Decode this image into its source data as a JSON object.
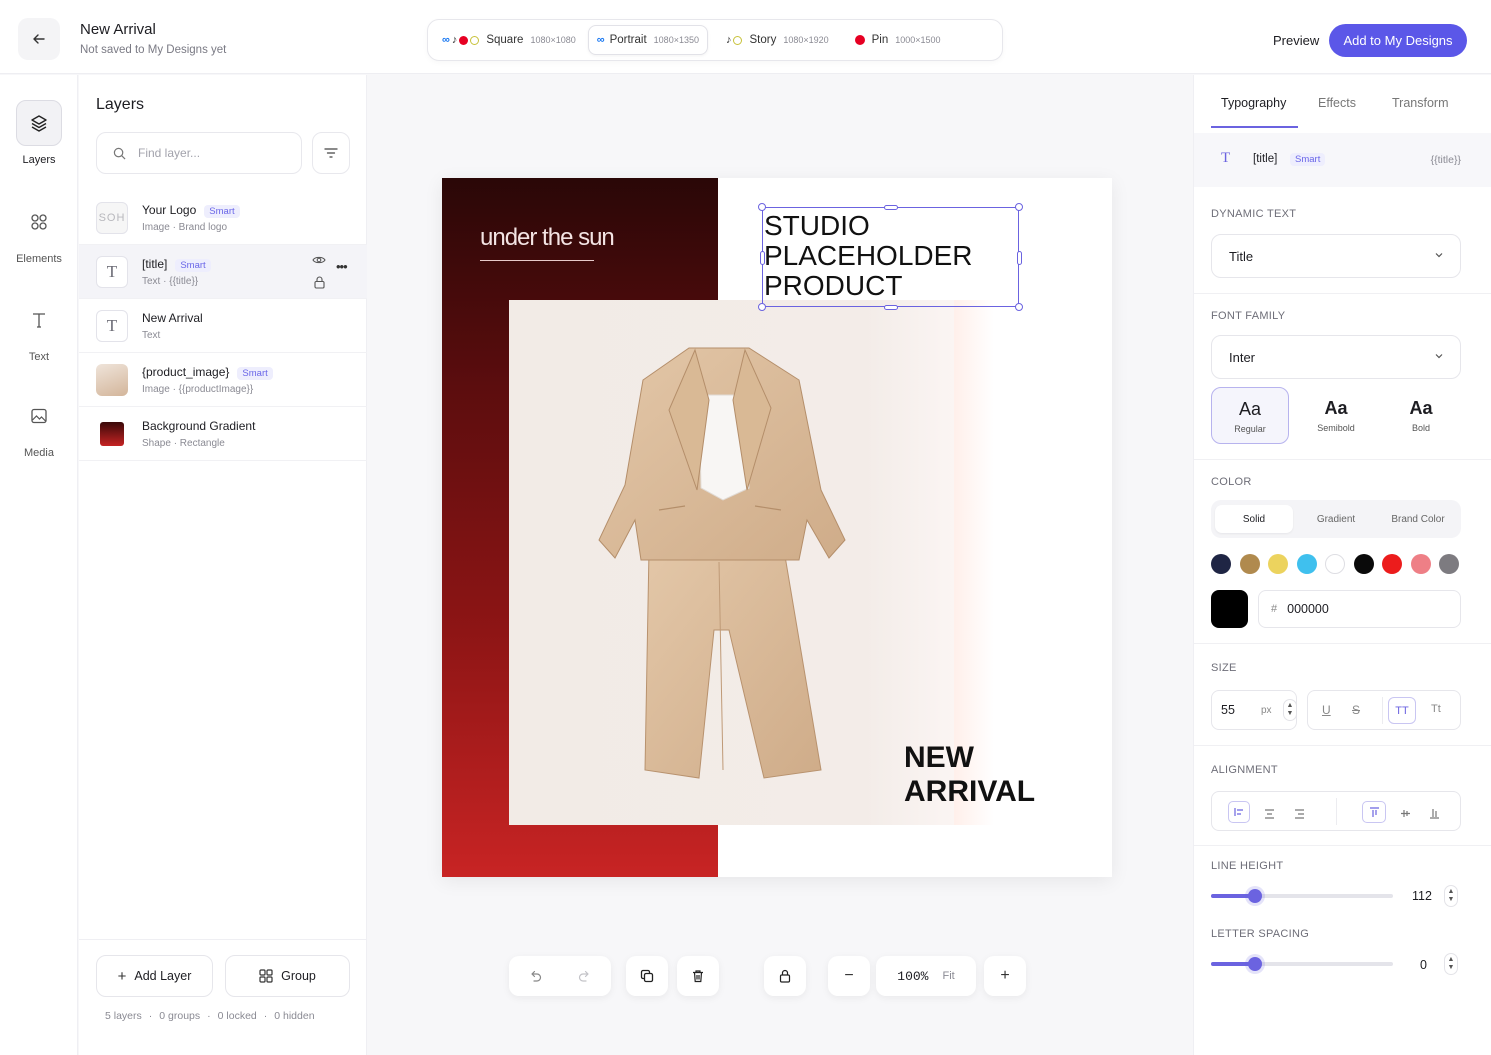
{
  "header": {
    "title": "New Arrival",
    "subtitle": "Not saved to My Designs yet",
    "preview_label": "Preview",
    "add_label": "Add to My Designs",
    "formats": [
      {
        "name": "Square",
        "dim": "1080×1080"
      },
      {
        "name": "Portrait",
        "dim": "1080×1350",
        "active": true
      },
      {
        "name": "Story",
        "dim": "1080×1920"
      },
      {
        "name": "Pin",
        "dim": "1000×1500"
      }
    ]
  },
  "rail": [
    {
      "label": "Layers",
      "icon": "layers-icon",
      "active": true
    },
    {
      "label": "Elements",
      "icon": "elements-icon"
    },
    {
      "label": "Text",
      "icon": "text-icon"
    },
    {
      "label": "Media",
      "icon": "image-icon"
    }
  ],
  "layers": {
    "title": "Layers",
    "search_placeholder": "Find layer...",
    "items": [
      {
        "name": "Your Logo",
        "smart": "Smart",
        "sub": "Image · Brand logo"
      },
      {
        "name": "[title]",
        "smart": "Smart",
        "sub": "Text · {{title}}"
      },
      {
        "name": "New Arrival",
        "smart": "",
        "sub": "Text"
      },
      {
        "name": "{product_image}",
        "smart": "Smart",
        "sub": "Image · {{productImage}}"
      },
      {
        "name": "Background Gradient",
        "smart": "",
        "sub": "Shape · Rectangle"
      }
    ],
    "add_layer_label": "Add Layer",
    "group_label": "Group",
    "stats": {
      "layers": "5 layers",
      "groups": "0 groups",
      "locked": "0 locked",
      "hidden": "0 hidden"
    }
  },
  "canvas": {
    "brand_text": "under the sun",
    "logo_thumb_text": "SOH",
    "title_text": "STUDIO\nPLACEHOLDER\nPRODUCT",
    "new_arrival_text": "NEW\nARRIVAL"
  },
  "toolbar": {
    "zoom": "100%",
    "fit_label": "Fit"
  },
  "props": {
    "tabs": [
      "Typography",
      "Effects",
      "Transform"
    ],
    "active_tab": "Typography",
    "chip": {
      "name": "[title]",
      "smart": "Smart",
      "token": "{{title}}"
    },
    "dynamic_text_label": "DYNAMIC TEXT",
    "dynamic_text_value": "Title",
    "font_family_label": "FONT FAMILY",
    "font_family_value": "Inter",
    "weights": [
      {
        "aa": "Aa",
        "label": "Regular",
        "active": true
      },
      {
        "aa": "Aa",
        "label": "Semibold"
      },
      {
        "aa": "Aa",
        "label": "Bold"
      }
    ],
    "color_label": "COLOR",
    "color_tabs": [
      "Solid",
      "Gradient",
      "Brand Color"
    ],
    "swatches": [
      "#1f2544",
      "#b08a4e",
      "#ecd35e",
      "#3fc0ee",
      "#ffffff",
      "#0a0a0a",
      "#ec1c1c",
      "#ee7f86",
      "#7d7b80"
    ],
    "hex_prefix": "#",
    "hex_value": "000000",
    "size_label": "SIZE",
    "size_value": "55",
    "size_unit": "px",
    "alignment_label": "ALIGNMENT",
    "line_height_label": "LINE HEIGHT",
    "line_height_value": "112",
    "line_height_fraction": 0.24,
    "letter_spacing_label": "LETTER SPACING",
    "letter_spacing_value": "0",
    "letter_spacing_fraction": 0.24
  }
}
